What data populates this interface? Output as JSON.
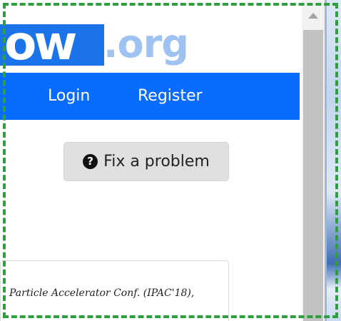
{
  "logo": {
    "main_text": "ow",
    "suffix_text": ".org"
  },
  "nav": {
    "login_label": "Login",
    "register_label": "Register"
  },
  "fix_problem": {
    "icon": "question-circle-icon",
    "label": "Fix a problem"
  },
  "card": {
    "text": "Particle Accelerator Conf. (IPAC'18),"
  },
  "scrollbar": {
    "up_icon": "chevron-up-icon"
  },
  "colors": {
    "navbar": "#0a6cff",
    "logo_block": "#1a73e8",
    "logo_suffix": "#9ec2f2",
    "frame": "#2e9e3f",
    "button_bg": "#e0e0e0"
  }
}
